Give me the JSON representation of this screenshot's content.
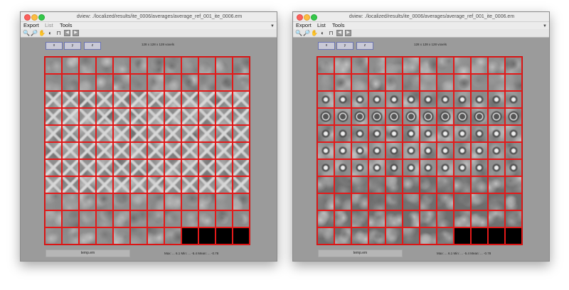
{
  "windows": [
    {
      "title": "dview: ./localized/results/ite_0006/averages/average_ref_001_ite_0006.em",
      "menus": [
        "Export",
        "List",
        "Tools"
      ],
      "axis_buttons": [
        "x",
        "y",
        "z"
      ],
      "dimensions": "128 x 128 x 128 voxels",
      "filename": "temp.em",
      "stats": "Max: ... 6.1 Min: ... -5.4 Mean: ... -0.78",
      "grid": {
        "cols": 12,
        "rows": 11,
        "filled_tiles": 128,
        "pattern": "particle-left"
      }
    },
    {
      "title": "dview: ./localized/results/ite_0006/averages/average_ref_001_ite_0006.em",
      "menus": [
        "Export",
        "List",
        "Tools"
      ],
      "axis_buttons": [
        "x",
        "y",
        "z"
      ],
      "dimensions": "128 x 128 x 128 voxels",
      "filename": "temp.em",
      "stats": "Max: ... 6.1 Min: ... -5.4 Mean: ... -0.78",
      "grid": {
        "cols": 12,
        "rows": 11,
        "filled_tiles": 128,
        "pattern": "particle-right"
      }
    }
  ],
  "toolbar_icons": [
    "zoom-in-icon",
    "zoom-out-icon",
    "pan-hand-icon",
    "contrast-icon",
    "pulse-icon",
    "back-icon",
    "forward-icon"
  ],
  "colors": {
    "tile_border": "#e31a1a",
    "empty_tile": "#000000",
    "window_bg": "#9b9b9b",
    "button_border": "#6b74b2"
  }
}
